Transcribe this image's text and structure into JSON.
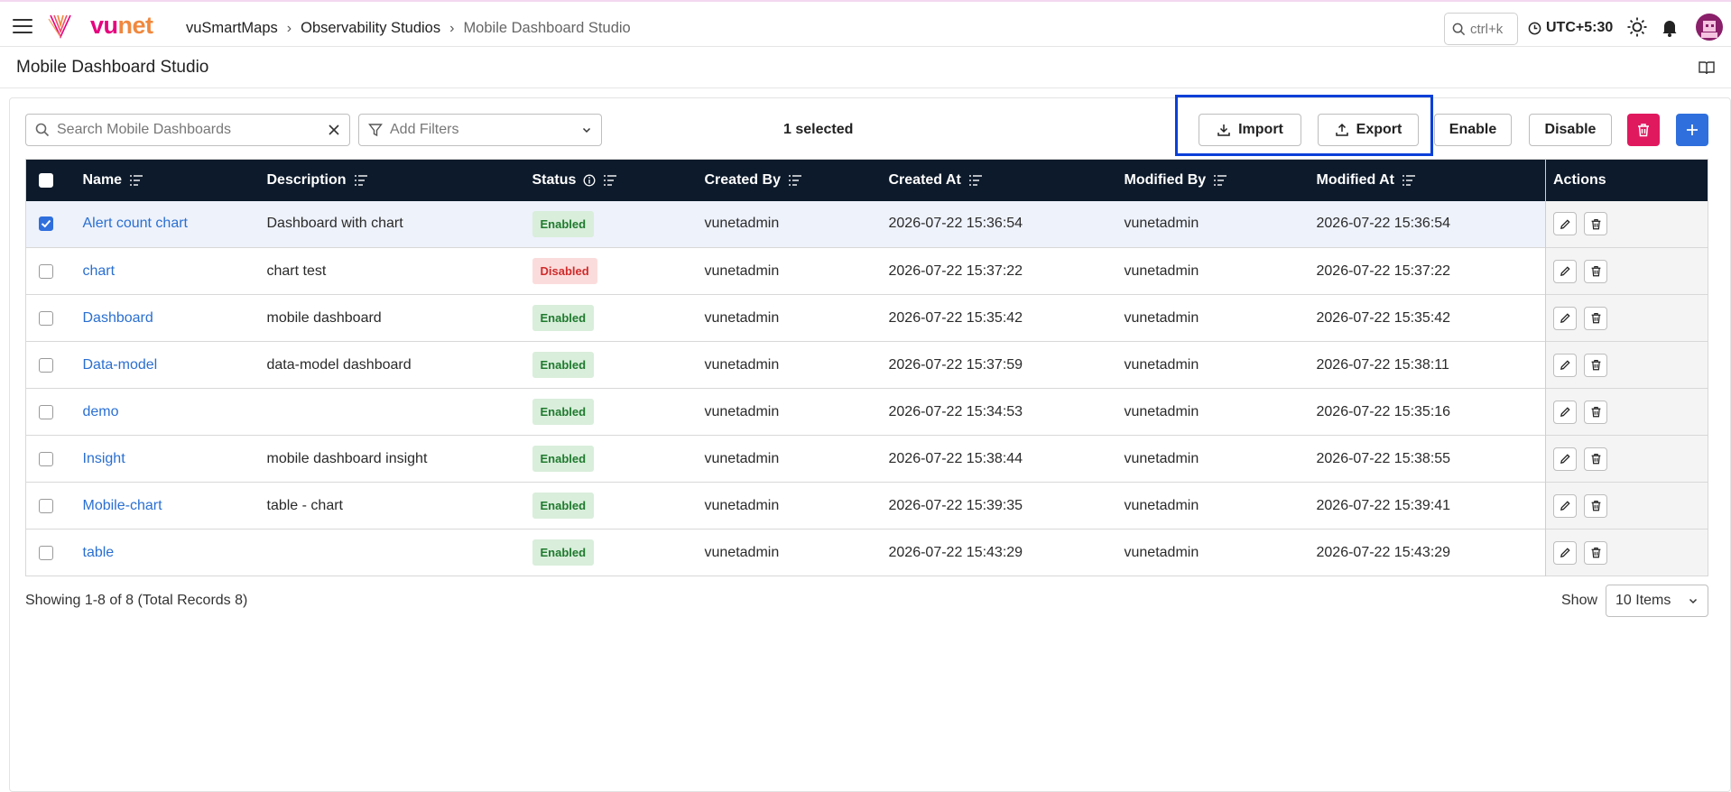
{
  "header": {
    "logo_text_a": "vu",
    "logo_text_b": "net",
    "breadcrumb": [
      "vuSmartMaps",
      "Observability Studios",
      "Mobile Dashboard Studio"
    ],
    "search_shortcut": "ctrl+k",
    "timezone": "UTC+5:30"
  },
  "page": {
    "title": "Mobile Dashboard Studio"
  },
  "toolbar": {
    "search_placeholder": "Search Mobile Dashboards",
    "filters_placeholder": "Add Filters",
    "selected_count": "1 selected",
    "import_label": "Import",
    "export_label": "Export",
    "enable_label": "Enable",
    "disable_label": "Disable"
  },
  "table": {
    "columns": [
      "Name",
      "Description",
      "Status",
      "Created By",
      "Created At",
      "Modified By",
      "Modified At",
      "Actions"
    ],
    "rows": [
      {
        "name": "Alert count chart",
        "description": "Dashboard with chart",
        "status": "Enabled",
        "created_by": "vunetadmin",
        "created_at": "2026-07-22 15:36:54",
        "modified_by": "vunetadmin",
        "modified_at": "2026-07-22 15:36:54",
        "selected": true
      },
      {
        "name": "chart",
        "description": "chart test",
        "status": "Disabled",
        "created_by": "vunetadmin",
        "created_at": "2026-07-22 15:37:22",
        "modified_by": "vunetadmin",
        "modified_at": "2026-07-22 15:37:22",
        "selected": false
      },
      {
        "name": "Dashboard",
        "description": "mobile dashboard",
        "status": "Enabled",
        "created_by": "vunetadmin",
        "created_at": "2026-07-22 15:35:42",
        "modified_by": "vunetadmin",
        "modified_at": "2026-07-22 15:35:42",
        "selected": false
      },
      {
        "name": "Data-model",
        "description": "data-model dashboard",
        "status": "Enabled",
        "created_by": "vunetadmin",
        "created_at": "2026-07-22 15:37:59",
        "modified_by": "vunetadmin",
        "modified_at": "2026-07-22 15:38:11",
        "selected": false
      },
      {
        "name": "demo",
        "description": "",
        "status": "Enabled",
        "created_by": "vunetadmin",
        "created_at": "2026-07-22 15:34:53",
        "modified_by": "vunetadmin",
        "modified_at": "2026-07-22 15:35:16",
        "selected": false
      },
      {
        "name": "Insight",
        "description": "mobile dashboard insight",
        "status": "Enabled",
        "created_by": "vunetadmin",
        "created_at": "2026-07-22 15:38:44",
        "modified_by": "vunetadmin",
        "modified_at": "2026-07-22 15:38:55",
        "selected": false
      },
      {
        "name": "Mobile-chart",
        "description": "table - chart",
        "status": "Enabled",
        "created_by": "vunetadmin",
        "created_at": "2026-07-22 15:39:35",
        "modified_by": "vunetadmin",
        "modified_at": "2026-07-22 15:39:41",
        "selected": false
      },
      {
        "name": "table",
        "description": "",
        "status": "Enabled",
        "created_by": "vunetadmin",
        "created_at": "2026-07-22 15:43:29",
        "modified_by": "vunetadmin",
        "modified_at": "2026-07-22 15:43:29",
        "selected": false
      }
    ]
  },
  "footer": {
    "records_text": "Showing 1-8 of 8 (Total Records 8)",
    "show_label": "Show",
    "page_size": "10 Items"
  },
  "colors": {
    "header_bg": "#0c1a2b",
    "accent_blue": "#2f6fdd",
    "delete_pink": "#e0195f",
    "highlight_box": "#0a3fd8",
    "enabled_green": "#1f7a2e",
    "disabled_red": "#d02b2b"
  }
}
